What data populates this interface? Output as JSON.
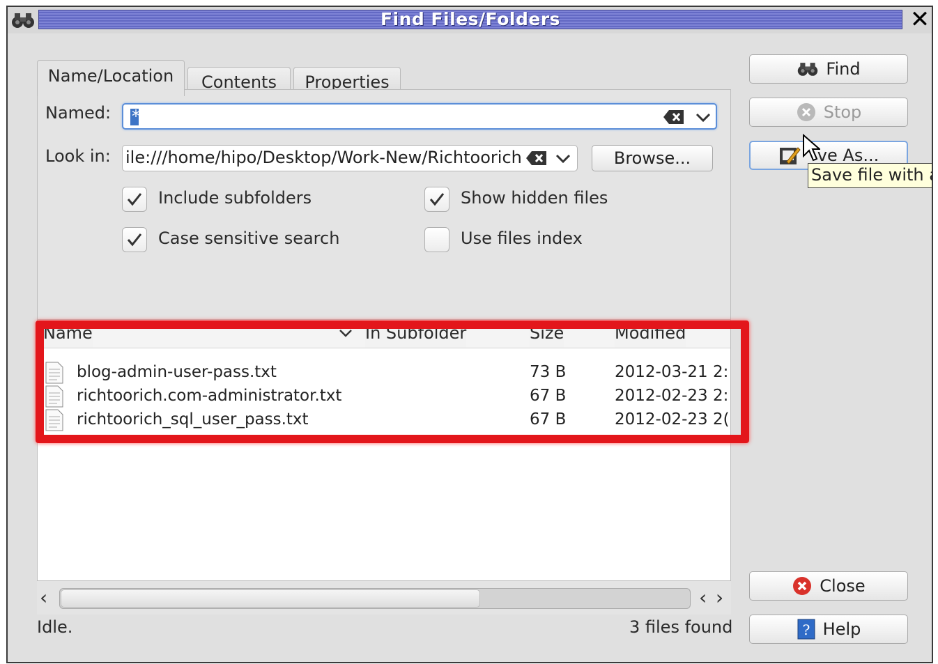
{
  "window": {
    "title": "Find Files/Folders",
    "close_glyph": "✕"
  },
  "tabs": [
    {
      "label": "Name/Location",
      "mnemonic": "L",
      "active": true
    },
    {
      "label": "Contents",
      "mnemonic": "o",
      "active": false
    },
    {
      "label": "Properties",
      "mnemonic": "P",
      "active": false
    }
  ],
  "named": {
    "label": "Named:",
    "value": "*"
  },
  "look_in": {
    "label": "Look in:",
    "value": "ile:///home/hipo/Desktop/Work-New/Richtoorich"
  },
  "browse_button": "Browse...",
  "options": {
    "include_subfolders": {
      "label": "Include subfolders",
      "checked": true
    },
    "case_sensitive": {
      "label": "Case sensitive search",
      "checked": true
    },
    "show_hidden": {
      "label": "Show hidden files",
      "checked": true
    },
    "use_index": {
      "label": "Use files index",
      "checked": false
    }
  },
  "results": {
    "columns": [
      "Name",
      "In Subfolder",
      "Size",
      "Modified"
    ],
    "rows": [
      {
        "name": "blog-admin-user-pass.txt",
        "subfolder": "",
        "size": "73 B",
        "modified": "2012-03-21 2:"
      },
      {
        "name": "richtoorich.com-administrator.txt",
        "subfolder": "",
        "size": "67 B",
        "modified": "2012-02-23 2:"
      },
      {
        "name": "richtoorich_sql_user_pass.txt",
        "subfolder": "",
        "size": "67 B",
        "modified": "2012-02-23 2("
      }
    ]
  },
  "buttons": {
    "find": "Find",
    "stop": "Stop",
    "save_as": "ve As...",
    "close": "Close",
    "help": "Help"
  },
  "tooltip": "Save file with a",
  "status": {
    "left": "Idle.",
    "right": "3 files found"
  },
  "icons": {
    "app": "binoculars-icon",
    "find": "binoculars-icon",
    "stop": "stop-icon",
    "save": "save-as-icon",
    "close": "close-circle-icon",
    "help": "help-book-icon",
    "file": "text-file-icon"
  },
  "colors": {
    "title_bar": "#6a70c8",
    "highlight_frame": "#e3161b",
    "focus": "#5b8ed8",
    "tooltip_bg": "#ffffdc"
  }
}
